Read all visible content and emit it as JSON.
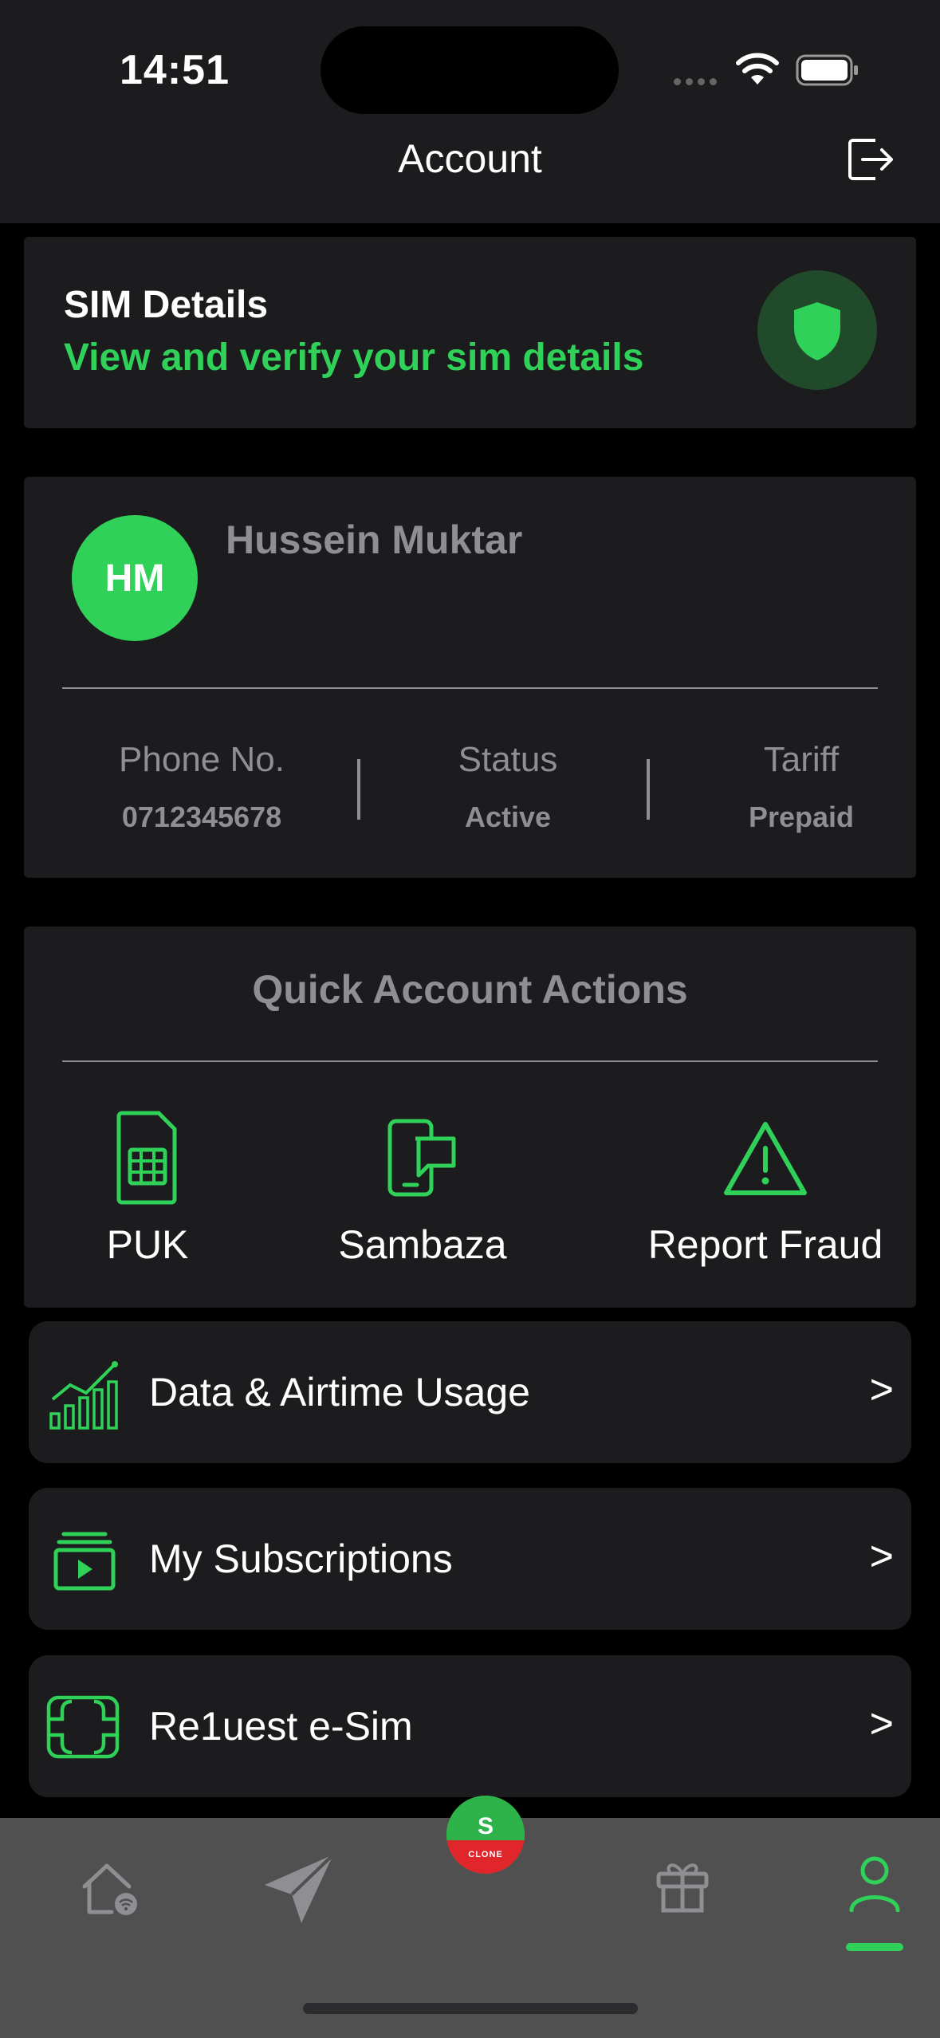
{
  "status_bar": {
    "time": "14:51"
  },
  "header": {
    "title": "Account",
    "logout_icon": "logout-icon"
  },
  "sim_card": {
    "title": "SIM Details",
    "subtitle": "View and verify your sim details",
    "icon": "shield-icon"
  },
  "profile": {
    "initials": "HM",
    "name": "Hussein Muktar",
    "stats": [
      {
        "label": "Phone No.",
        "value": "0712345678"
      },
      {
        "label": "Status",
        "value": "Active"
      },
      {
        "label": "Tariff",
        "value": "Prepaid"
      }
    ]
  },
  "quick_actions": {
    "title": "Quick Account Actions",
    "items": [
      {
        "label": "PUK",
        "icon": "sim-card-icon"
      },
      {
        "label": "Sambaza",
        "icon": "phone-share-icon"
      },
      {
        "label": "Report Fraud",
        "icon": "warning-icon"
      }
    ]
  },
  "menu": [
    {
      "label": "Data & Airtime Usage",
      "icon": "chart-icon",
      "chevron": ">"
    },
    {
      "label": "My Subscriptions",
      "icon": "subscriptions-icon",
      "chevron": ">"
    },
    {
      "label": "Re1uest e-Sim",
      "icon": "esim-icon",
      "chevron": ">"
    }
  ],
  "tab_bar": {
    "tabs": [
      "home-icon",
      "send-icon",
      "app-logo",
      "gift-icon",
      "profile-icon"
    ],
    "logo_letter": "S",
    "logo_text": "CLONE",
    "active": "profile-icon"
  },
  "colors": {
    "accent": "#30d158",
    "card": "#1c1c1e",
    "muted": "#8e8e93"
  }
}
